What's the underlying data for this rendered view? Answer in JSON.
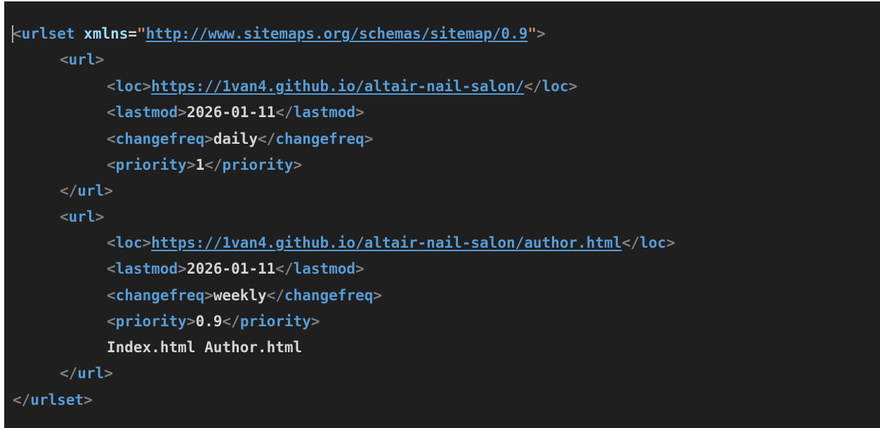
{
  "code": {
    "urlset_open": "urlset",
    "xmlns_attr": "xmlns",
    "xmlns_value": "http://www.sitemaps.org/schemas/sitemap/0.9",
    "url_tag": "url",
    "loc_tag": "loc",
    "lastmod_tag": "lastmod",
    "changefreq_tag": "changefreq",
    "priority_tag": "priority",
    "urls": [
      {
        "loc": "https://1van4.github.io/altair-nail-salon/",
        "lastmod": "2026-01-11",
        "changefreq": "daily",
        "priority": "1"
      },
      {
        "loc": "https://1van4.github.io/altair-nail-salon/author.html",
        "lastmod": "2026-01-11",
        "changefreq": "weekly",
        "priority": "0.9"
      }
    ],
    "stray_text": "Index.html Author.html"
  },
  "colors": {
    "background": "#1f1f1f",
    "punctuation": "#808080",
    "tag": "#569cd6",
    "attribute": "#9cdcfe",
    "string": "#ce9178",
    "text": "#d4d4d4"
  }
}
